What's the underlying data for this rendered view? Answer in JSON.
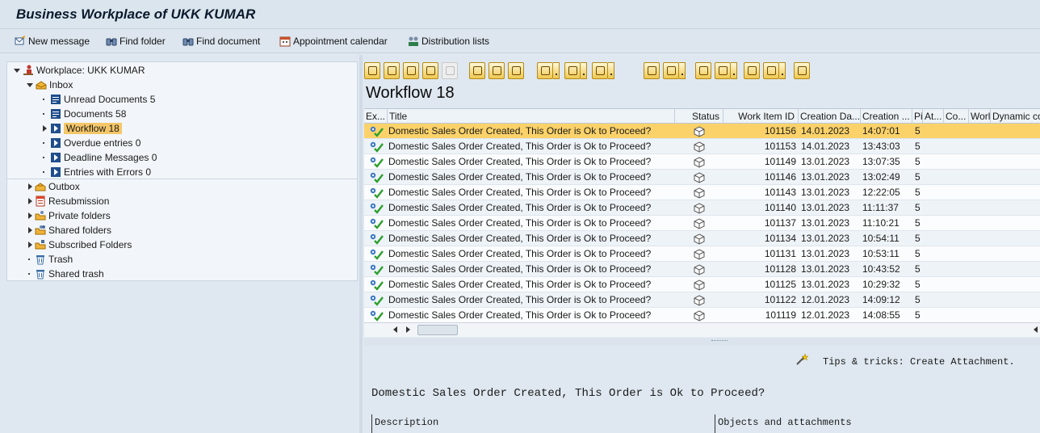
{
  "window": {
    "title": "Business Workplace of UKK KUMAR"
  },
  "appbar": [
    {
      "label": "New message",
      "icon": "new-message-icon"
    },
    {
      "label": "Find folder",
      "icon": "binoculars-icon"
    },
    {
      "label": "Find document",
      "icon": "binoculars-icon"
    },
    {
      "label": "Appointment calendar",
      "icon": "calendar-icon"
    },
    {
      "label": "Distribution lists",
      "icon": "distribution-list-icon"
    }
  ],
  "tree": {
    "root": "Workplace: UKK KUMAR",
    "inbox": "Inbox",
    "inbox_items": [
      {
        "label": "Unread Documents 5",
        "icon": "document-icon"
      },
      {
        "label": "Documents 58",
        "icon": "document-icon"
      },
      {
        "label": "Workflow 18",
        "icon": "workflow-icon",
        "selected": true
      },
      {
        "label": "Overdue entries 0",
        "icon": "workflow-icon"
      },
      {
        "label": "Deadline Messages 0",
        "icon": "workflow-icon"
      },
      {
        "label": "Entries with Errors 0",
        "icon": "workflow-icon"
      }
    ],
    "other": [
      {
        "label": "Outbox",
        "icon": "outbox-icon"
      },
      {
        "label": "Resubmission",
        "icon": "resubmission-icon"
      },
      {
        "label": "Private folders",
        "icon": "private-folder-icon"
      },
      {
        "label": "Shared folders",
        "icon": "shared-folder-icon"
      },
      {
        "label": "Subscribed Folders",
        "icon": "subscribed-folder-icon"
      },
      {
        "label": "Trash",
        "icon": "trash-icon"
      },
      {
        "label": "Shared trash",
        "icon": "trash-icon"
      }
    ]
  },
  "list_title": "Workflow 18",
  "grid": {
    "columns": [
      "Ex...",
      "Title",
      "Status",
      "Work Item ID",
      "Creation Da...",
      "Creation ...",
      "Pi",
      "At...",
      "Co...",
      "Worl",
      "Dynamic co"
    ],
    "rows": [
      {
        "title": "Domestic Sales Order Created, This Order is Ok to Proceed?",
        "id": "101156",
        "date": "14.01.2023",
        "time": "14:07:01",
        "priority": "5"
      },
      {
        "title": "Domestic Sales Order Created, This Order is Ok to Proceed?",
        "id": "101153",
        "date": "14.01.2023",
        "time": "13:43:03",
        "priority": "5"
      },
      {
        "title": "Domestic Sales Order Created, This Order is Ok to Proceed?",
        "id": "101149",
        "date": "13.01.2023",
        "time": "13:07:35",
        "priority": "5"
      },
      {
        "title": "Domestic Sales Order Created, This Order is Ok to Proceed?",
        "id": "101146",
        "date": "13.01.2023",
        "time": "13:02:49",
        "priority": "5"
      },
      {
        "title": "Domestic Sales Order Created, This Order is Ok to Proceed?",
        "id": "101143",
        "date": "13.01.2023",
        "time": "12:22:05",
        "priority": "5"
      },
      {
        "title": "Domestic Sales Order Created, This Order is Ok to Proceed?",
        "id": "101140",
        "date": "13.01.2023",
        "time": "11:11:37",
        "priority": "5"
      },
      {
        "title": "Domestic Sales Order Created, This Order is Ok to Proceed?",
        "id": "101137",
        "date": "13.01.2023",
        "time": "11:10:21",
        "priority": "5"
      },
      {
        "title": "Domestic Sales Order Created, This Order is Ok to Proceed?",
        "id": "101134",
        "date": "13.01.2023",
        "time": "10:54:11",
        "priority": "5"
      },
      {
        "title": "Domestic Sales Order Created, This Order is Ok to Proceed?",
        "id": "101131",
        "date": "13.01.2023",
        "time": "10:53:11",
        "priority": "5"
      },
      {
        "title": "Domestic Sales Order Created, This Order is Ok to Proceed?",
        "id": "101128",
        "date": "13.01.2023",
        "time": "10:43:52",
        "priority": "5"
      },
      {
        "title": "Domestic Sales Order Created, This Order is Ok to Proceed?",
        "id": "101125",
        "date": "13.01.2023",
        "time": "10:29:32",
        "priority": "5"
      },
      {
        "title": "Domestic Sales Order Created, This Order is Ok to Proceed?",
        "id": "101122",
        "date": "12.01.2023",
        "time": "14:09:12",
        "priority": "5"
      },
      {
        "title": "Domestic Sales Order Created, This Order is Ok to Proceed?",
        "id": "101119",
        "date": "12.01.2023",
        "time": "14:08:55",
        "priority": "5"
      }
    ]
  },
  "preview": {
    "tips": "Tips & tricks:  Create Attachment.",
    "title": "Domestic Sales Order Created, This Order is Ok to Proceed?",
    "description_header": "Description",
    "objects_header": "Objects and attachments"
  },
  "colors": {
    "selection": "#fbd26a",
    "tree_selection": "#f5c76a",
    "accent_blue": "#1a5fb4"
  }
}
